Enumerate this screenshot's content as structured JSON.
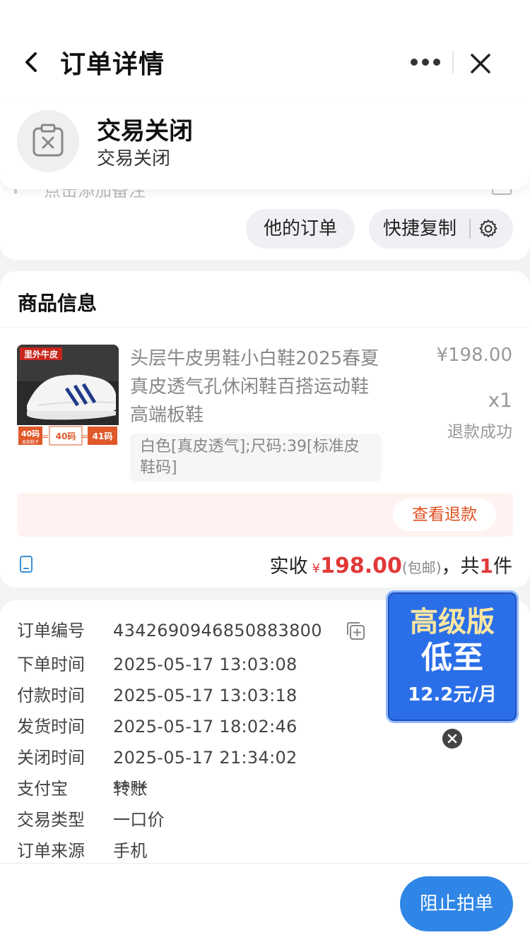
{
  "header": {
    "title": "订单详情",
    "back_icon": "chevron-left-icon",
    "more_icon": "more-dots-icon",
    "close_icon": "close-icon"
  },
  "status": {
    "title": "交易关闭",
    "subtitle": "交易关闭",
    "icon": "closed-clipboard-icon"
  },
  "actions": {
    "his_orders": "他的订单",
    "quick_copy": "快捷复制",
    "ghost_text": "点击添加备注",
    "settings_icon": "gear-icon"
  },
  "goods": {
    "header": "商品信息",
    "thumb": {
      "banner": "里外牛皮",
      "tag1": "40码",
      "tag1_sub": "本款鞋子",
      "tag2": "40码",
      "tag3": "41码"
    },
    "name": "头层牛皮男鞋小白鞋2025春夏真皮透气孔休闲鞋百搭运动鞋高端板鞋",
    "sku": "白色[真皮透气];尺码:39[标准皮鞋码]",
    "price": "¥198.00",
    "qty": "x1",
    "refund_status": "退款成功",
    "refund_button": "查看退款",
    "total": {
      "label": "实收",
      "currency": "¥",
      "amount": "198.00",
      "shipping": "(包邮)",
      "sep": "，共",
      "count": "1",
      "unit": "件"
    }
  },
  "order_info": {
    "rows": [
      {
        "label": "订单编号",
        "value": "4342690946850883800"
      },
      {
        "label": "下单时间",
        "value": "2025-05-17 13:03:08"
      },
      {
        "label": "付款时间",
        "value": "2025-05-17 13:03:18"
      },
      {
        "label": "发货时间",
        "value": "2025-05-17 18:02:46"
      },
      {
        "label": "关闭时间",
        "value": "2025-05-17 21:34:02"
      },
      {
        "label": "支付宝",
        "value": "****",
        "link": "转账"
      },
      {
        "label": "交易类型",
        "value": "一口价"
      },
      {
        "label": "订单来源",
        "value": "手机"
      }
    ]
  },
  "promo": {
    "line1": "高级版",
    "line2": "低至",
    "line3": "12.2元/月"
  },
  "bottom": {
    "block_order": "阻止拍单"
  },
  "colors": {
    "accent_blue": "#2f86e6",
    "price_red": "#e23838",
    "refund_orange": "#e05020",
    "promo_blue": "#2b6fe8"
  }
}
